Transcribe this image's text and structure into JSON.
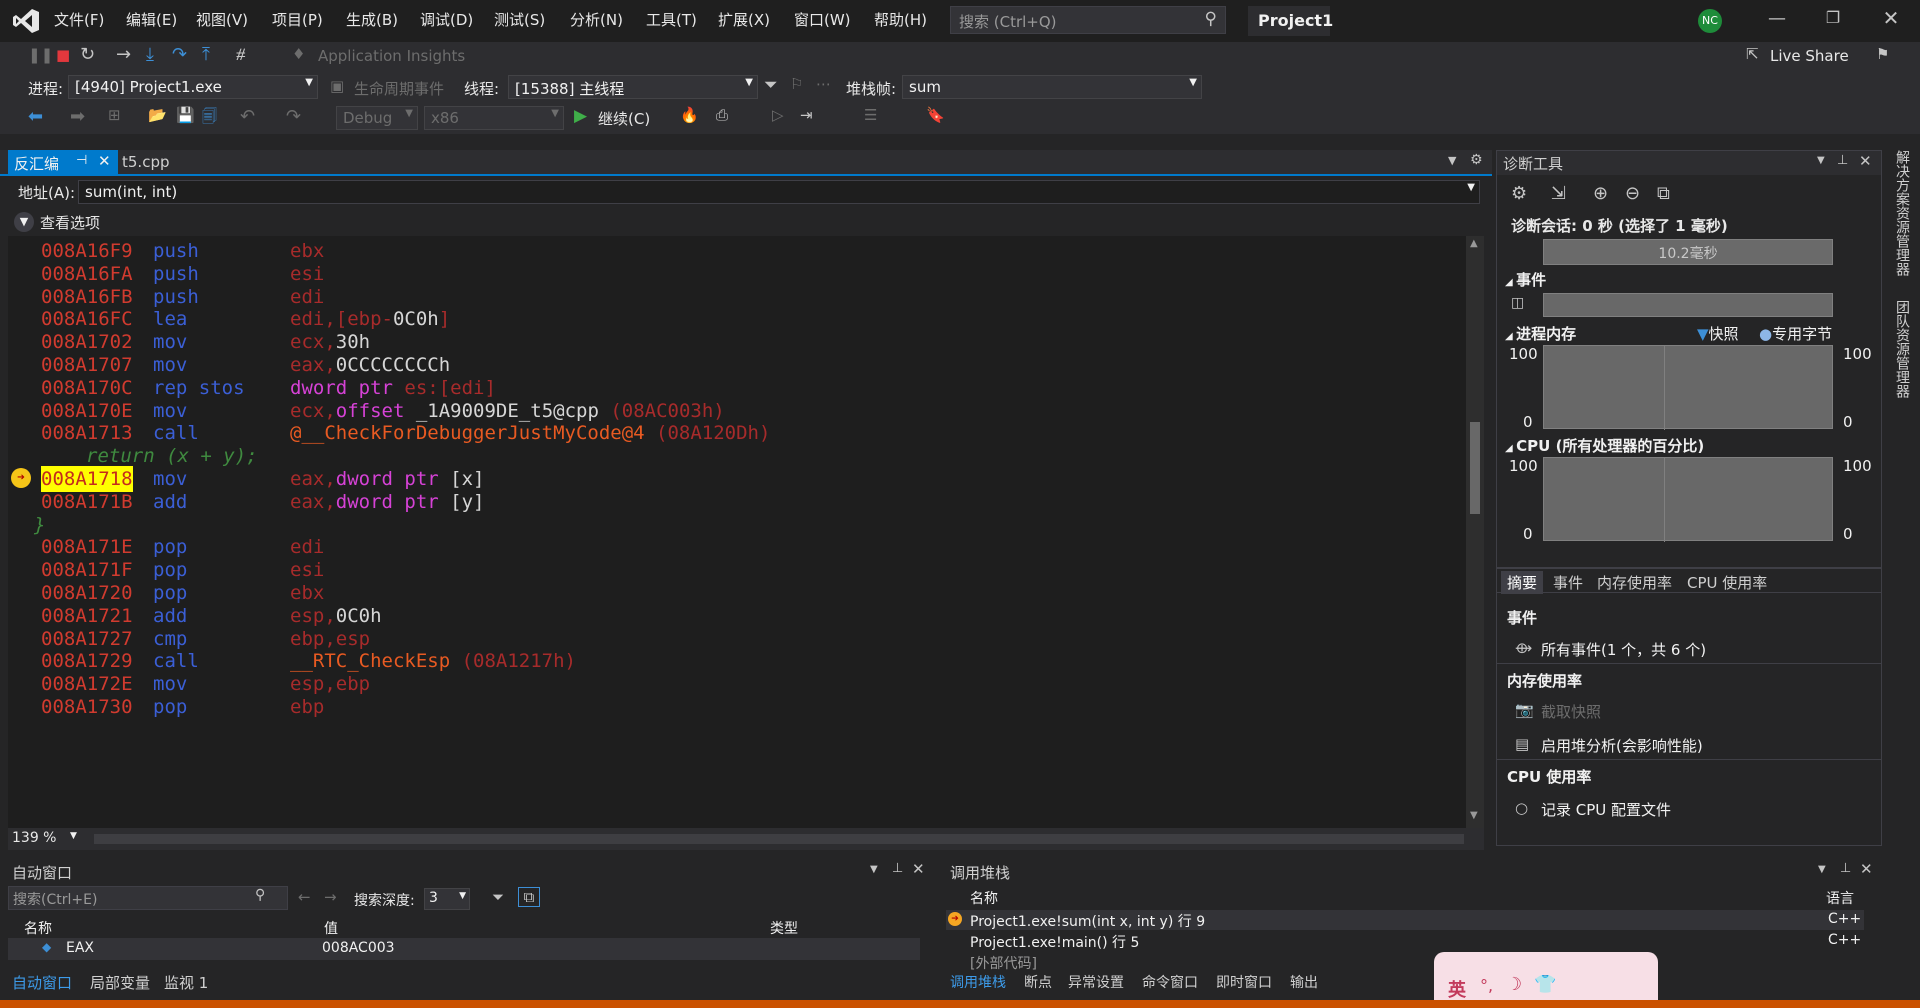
{
  "menu": [
    "文件(F)",
    "编辑(E)",
    "视图(V)",
    "项目(P)",
    "生成(B)",
    "调试(D)",
    "测试(S)",
    "分析(N)",
    "工具(T)",
    "扩展(X)",
    "窗口(W)",
    "帮助(H)"
  ],
  "search_placeholder": "搜索 (Ctrl+Q)",
  "project_name": "Project1",
  "user_initials": "NC",
  "live_share": "Live Share",
  "app_insights": "Application Insights",
  "process_label": "进程:",
  "process_value": "[4940] Project1.exe",
  "lifecycle_label": "生命周期事件",
  "thread_label": "线程:",
  "thread_value": "[15388] 主线程",
  "stackframe_label": "堆栈帧:",
  "stackframe_value": "sum",
  "config": "Debug",
  "platform": "x86",
  "continue_label": "继续(C)",
  "doc_tabs": [
    "反汇编",
    "t5.cpp"
  ],
  "address_label": "地址(A):",
  "address_value": "sum(int, int)",
  "view_options": "查看选项",
  "code_lines": [
    {
      "addr": "008A16F9",
      "op": "push",
      "args": "ebx"
    },
    {
      "addr": "008A16FA",
      "op": "push",
      "args": "esi"
    },
    {
      "addr": "008A16FB",
      "op": "push",
      "args": "edi"
    },
    {
      "addr": "008A16FC",
      "op": "lea",
      "args": "edi,[ebp-0C0h]"
    },
    {
      "addr": "008A1702",
      "op": "mov",
      "args": "ecx,30h"
    },
    {
      "addr": "008A1707",
      "op": "mov",
      "args": "eax,0CCCCCCCCh"
    },
    {
      "addr": "008A170C",
      "op": "rep stos",
      "args": "dword ptr es:[edi]"
    },
    {
      "addr": "008A170E",
      "op": "mov",
      "args": "ecx,offset _1A9009DE_t5@cpp (08AC003h)"
    },
    {
      "addr": "008A1713",
      "op": "call",
      "args": "@__CheckForDebuggerJustMyCode@4 (08A120Dh)"
    },
    {
      "src": "return (x + y);"
    },
    {
      "addr": "008A1718",
      "op": "mov",
      "args": "eax,dword ptr [x]",
      "current": true
    },
    {
      "addr": "008A171B",
      "op": "add",
      "args": "eax,dword ptr [y]"
    },
    {
      "src": "}"
    },
    {
      "addr": "008A171E",
      "op": "pop",
      "args": "edi"
    },
    {
      "addr": "008A171F",
      "op": "pop",
      "args": "esi"
    },
    {
      "addr": "008A1720",
      "op": "pop",
      "args": "ebx"
    },
    {
      "addr": "008A1721",
      "op": "add",
      "args": "esp,0C0h"
    },
    {
      "addr": "008A1727",
      "op": "cmp",
      "args": "ebp,esp"
    },
    {
      "addr": "008A1729",
      "op": "call",
      "args": "__RTC_CheckEsp (08A1217h)"
    },
    {
      "addr": "008A172E",
      "op": "mov",
      "args": "esp,ebp"
    },
    {
      "addr": "008A1730",
      "op": "pop",
      "args": "ebp"
    }
  ],
  "zoom": "139 %",
  "diag": {
    "title": "诊断工具",
    "session": "诊断会话: 0 秒 (选择了 1 毫秒)",
    "timeline": "10.2毫秒",
    "events_hdr": "事件",
    "memory_hdr": "进程内存",
    "snapshot_legend": "快照",
    "private_legend": "专用字节",
    "cpu_hdr": "CPU (所有处理器的百分比)",
    "axis_top": "100",
    "axis_bottom": "0",
    "tabs": [
      "摘要",
      "事件",
      "内存使用率",
      "CPU 使用率"
    ],
    "sec_events": "事件",
    "all_events": "所有事件(1 个，共 6 个)",
    "sec_memory": "内存使用率",
    "take_snapshot": "截取快照",
    "heap_profiling": "启用堆分析(会影响性能)",
    "sec_cpu": "CPU 使用率",
    "record_cpu": "记录 CPU 配置文件"
  },
  "side_tabs": [
    "解决方案资源管理器",
    "团队资源管理器"
  ],
  "autos": {
    "title": "自动窗口",
    "search_placeholder": "搜索(Ctrl+E)",
    "depth_label": "搜索深度:",
    "depth_value": "3",
    "cols": [
      "名称",
      "值",
      "类型"
    ],
    "row_name": "EAX",
    "row_value": "008AC003",
    "tabs": [
      "自动窗口",
      "局部变量",
      "监视 1"
    ]
  },
  "callstack": {
    "title": "调用堆栈",
    "cols": [
      "名称",
      "语言"
    ],
    "rows": [
      {
        "name": "Project1.exe!sum(int x, int y) 行 9",
        "lang": "C++"
      },
      {
        "name": "Project1.exe!main() 行 5",
        "lang": "C++"
      },
      {
        "name": "[外部代码]",
        "lang": ""
      }
    ],
    "tabs": [
      "调用堆栈",
      "断点",
      "异常设置",
      "命令窗口",
      "即时窗口",
      "输出"
    ]
  },
  "ime": "英",
  "colors": {
    "accent": "#007acc",
    "status_bar": "#ca5100",
    "current_line": "#ffff00"
  }
}
